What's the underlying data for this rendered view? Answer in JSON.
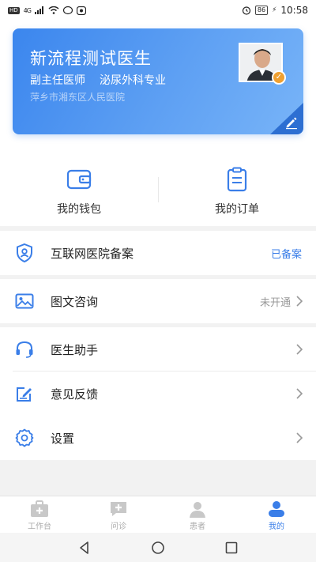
{
  "status_bar": {
    "left_badge": "HD",
    "signal": "4G",
    "battery": "86",
    "time": "10:58"
  },
  "doctor": {
    "name": "新流程测试医生",
    "title": "副主任医师",
    "department": "泌尿外科专业",
    "hospital": "萍乡市湘东区人民医院",
    "badge": "✓"
  },
  "quick_actions": [
    {
      "label": "我的钱包",
      "icon": "wallet-icon"
    },
    {
      "label": "我的订单",
      "icon": "order-icon"
    }
  ],
  "menu": {
    "filing": {
      "label": "互联网医院备案",
      "status": "已备案",
      "icon": "shield-user-icon"
    },
    "consult": {
      "label": "图文咨询",
      "status": "未开通",
      "icon": "image-icon"
    },
    "assistant": {
      "label": "医生助手",
      "icon": "headset-icon"
    },
    "feedback": {
      "label": "意见反馈",
      "icon": "edit-note-icon"
    },
    "settings": {
      "label": "设置",
      "icon": "gear-icon"
    }
  },
  "bottom_nav": [
    {
      "label": "工作台",
      "icon": "workbench-icon",
      "active": false
    },
    {
      "label": "问诊",
      "icon": "consult-icon",
      "active": false
    },
    {
      "label": "患者",
      "icon": "patient-icon",
      "active": false
    },
    {
      "label": "我的",
      "icon": "profile-icon",
      "active": true
    }
  ],
  "colors": {
    "accent": "#3a7ee8",
    "card_gradient_start": "#3b86ee",
    "card_gradient_end": "#78b4f8",
    "muted": "#999999"
  }
}
